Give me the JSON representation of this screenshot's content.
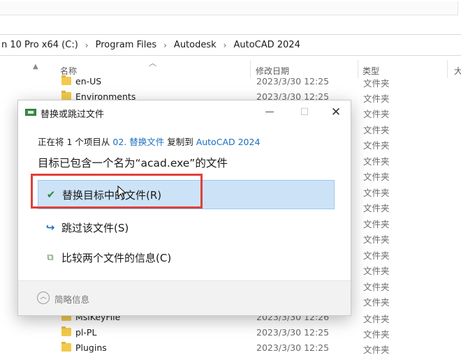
{
  "breadcrumb": [
    "n 10 Pro x64 (C:)",
    "Program Files",
    "Autodesk",
    "AutoCAD 2024"
  ],
  "columns": {
    "name": "名称",
    "date": "修改日期",
    "type": "类型",
    "size": "大"
  },
  "files_top": [
    {
      "name": "en-US",
      "date": "2023/3/30 12:25",
      "type": "文件夹"
    },
    {
      "name": "Environments",
      "date": "2023/3/30 12:25",
      "type": "文件夹"
    }
  ],
  "type_column_repeat": [
    "文件夹",
    "文件夹",
    "文件夹",
    "文件夹",
    "文件夹",
    "文件夹",
    "文件夹",
    "文件夹",
    "文件夹",
    "文件夹",
    "文件夹",
    "文件夹",
    "文件夹",
    "文件夹"
  ],
  "files_bottom": [
    {
      "name": "MsiKeyFile",
      "date": "2023/3/30 12:26",
      "type": "文件夹"
    },
    {
      "name": "pl-PL",
      "date": "2023/3/30 12:25",
      "type": "文件夹"
    },
    {
      "name": "Plugins",
      "date": "2023/3/30 12:25",
      "type": "文件夹"
    }
  ],
  "dialog": {
    "title": "替换或跳过文件",
    "info_prefix": "正在将 1 个项目从 ",
    "info_source": "02. 替换文件",
    "info_middle": " 复制到 ",
    "info_dest": "AutoCAD 2024",
    "heading": "目标已包含一个名为“acad.exe”的文件",
    "option_replace": "替换目标中的文件(R)",
    "option_skip": "跳过该文件(S)",
    "option_compare": "比较两个文件的信息(C)",
    "fewer_details": "简略信息"
  },
  "colors": {
    "accent": "#1a6ec2",
    "highlight_box": "#e0403c",
    "selected_bg": "#cce3f7",
    "check": "#2f8a3e"
  }
}
